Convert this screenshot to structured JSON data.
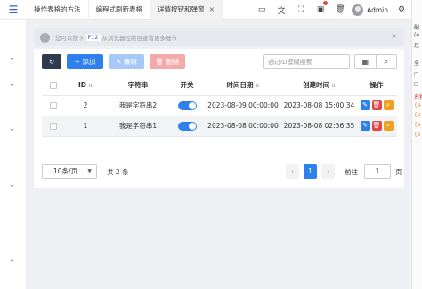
{
  "tabs": [
    {
      "label": "操作表格的方法"
    },
    {
      "label": "编程式刷新表格"
    },
    {
      "label": "详情按钮和弹窗",
      "close": "×"
    }
  ],
  "header": {
    "user": "Admin"
  },
  "notice": {
    "icon_text": "i",
    "pre": "您可以按下",
    "key": "F12",
    "post": "从浏览器控制台查看更多细节",
    "close": "×"
  },
  "toolbar": {
    "refresh_icon": "↻",
    "add_label": "+ 添加",
    "edit_label": "✎ 编辑",
    "delete_label": "🗑 删除",
    "search_placeholder": "通过ID模糊搜索",
    "grid_icon": "▦",
    "search_icon": "⌕"
  },
  "table": {
    "columns": [
      "ID",
      "字符串",
      "开关",
      "时间日期",
      "创建时间",
      "操作"
    ],
    "rows": [
      {
        "id": "2",
        "name": "我是字符串2",
        "datetime": "2023-08-09 00:00:00",
        "created": "2023-08-08 15:00:34"
      },
      {
        "id": "1",
        "name": "我是字符串1",
        "datetime": "2023-08-08 00:00:00",
        "created": "2023-08-08 02:56:35"
      }
    ]
  },
  "pager": {
    "page_size": "10条/页",
    "total": "共 2 条",
    "prev": "‹",
    "current": "1",
    "next": "›",
    "goto_label": "前往",
    "goto_value": "1",
    "page_word": "页"
  },
  "right_strip": [
    "配",
    "(e",
    "过",
    "全",
    "",
    "",
    "名称",
    "{e",
    "{e",
    "{e",
    "{e"
  ],
  "colors": {
    "primary": "#2f80ed",
    "danger": "#e04848",
    "warning": "#f0a020",
    "dark": "#2e3b4e"
  }
}
